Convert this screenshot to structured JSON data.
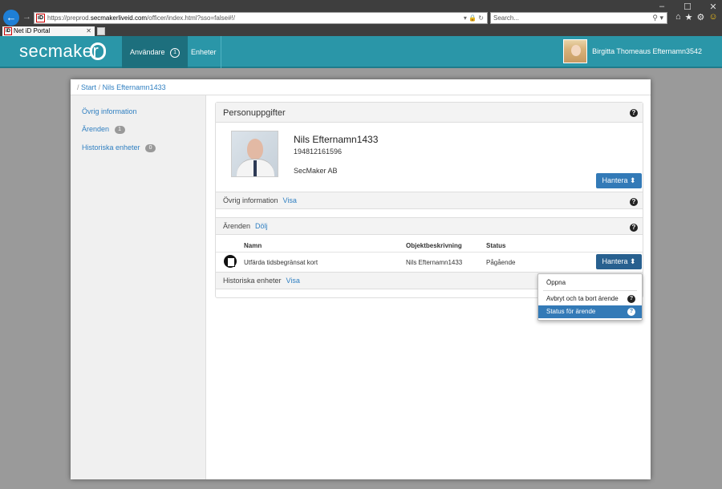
{
  "browser": {
    "window_controls": [
      "–",
      "☐",
      "✕"
    ],
    "url_prefix": "https://preprod.",
    "url_host": "secmakerliveid.com",
    "url_path": "/officer/index.html?sso=false#!/",
    "search_placeholder": "Search...",
    "tab_title": "Net iD Portal",
    "favicon_text": "iD"
  },
  "header": {
    "logo": "secmaker",
    "nav": [
      {
        "label": "Användare",
        "badge": "1"
      },
      {
        "label": "Enheter"
      }
    ],
    "user_name": "Birgitta Thomeaus Efternamn3542"
  },
  "breadcrumb": {
    "sep": "/",
    "items": [
      "Start",
      "Nils Efternamn1433"
    ]
  },
  "sidebar": {
    "items": [
      {
        "label": "Övrig information"
      },
      {
        "label": "Ärenden",
        "count": "1"
      },
      {
        "label": "Historiska enheter",
        "count": "0"
      }
    ]
  },
  "person": {
    "section_title": "Personuppgifter",
    "name": "Nils Efternamn1433",
    "id_number": "194812161596",
    "organization": "SecMaker AB",
    "manage_label": "Hantera ⬍"
  },
  "sections": {
    "other_info": {
      "title": "Övrig information",
      "link": "Visa"
    },
    "cases": {
      "title": "Ärenden",
      "link": "Dölj"
    },
    "history": {
      "title": "Historiska enheter",
      "link": "Visa"
    }
  },
  "cases_table": {
    "columns": [
      "Namn",
      "Objektbeskrivning",
      "Status"
    ],
    "rows": [
      {
        "name": "Utfärda tidsbegränsat kort",
        "object": "Nils Efternamn1433",
        "status": "Pågående",
        "action": "Hantera ⬍"
      }
    ]
  },
  "dropdown": {
    "items": [
      "Öppna",
      "Avbryt och ta bort ärende",
      "Status för ärende"
    ],
    "selected_index": 2
  },
  "help_glyph": "?",
  "colors": {
    "brand_teal": "#2a96a8",
    "primary_blue": "#337ab7",
    "link_blue": "#2f7fc1"
  }
}
